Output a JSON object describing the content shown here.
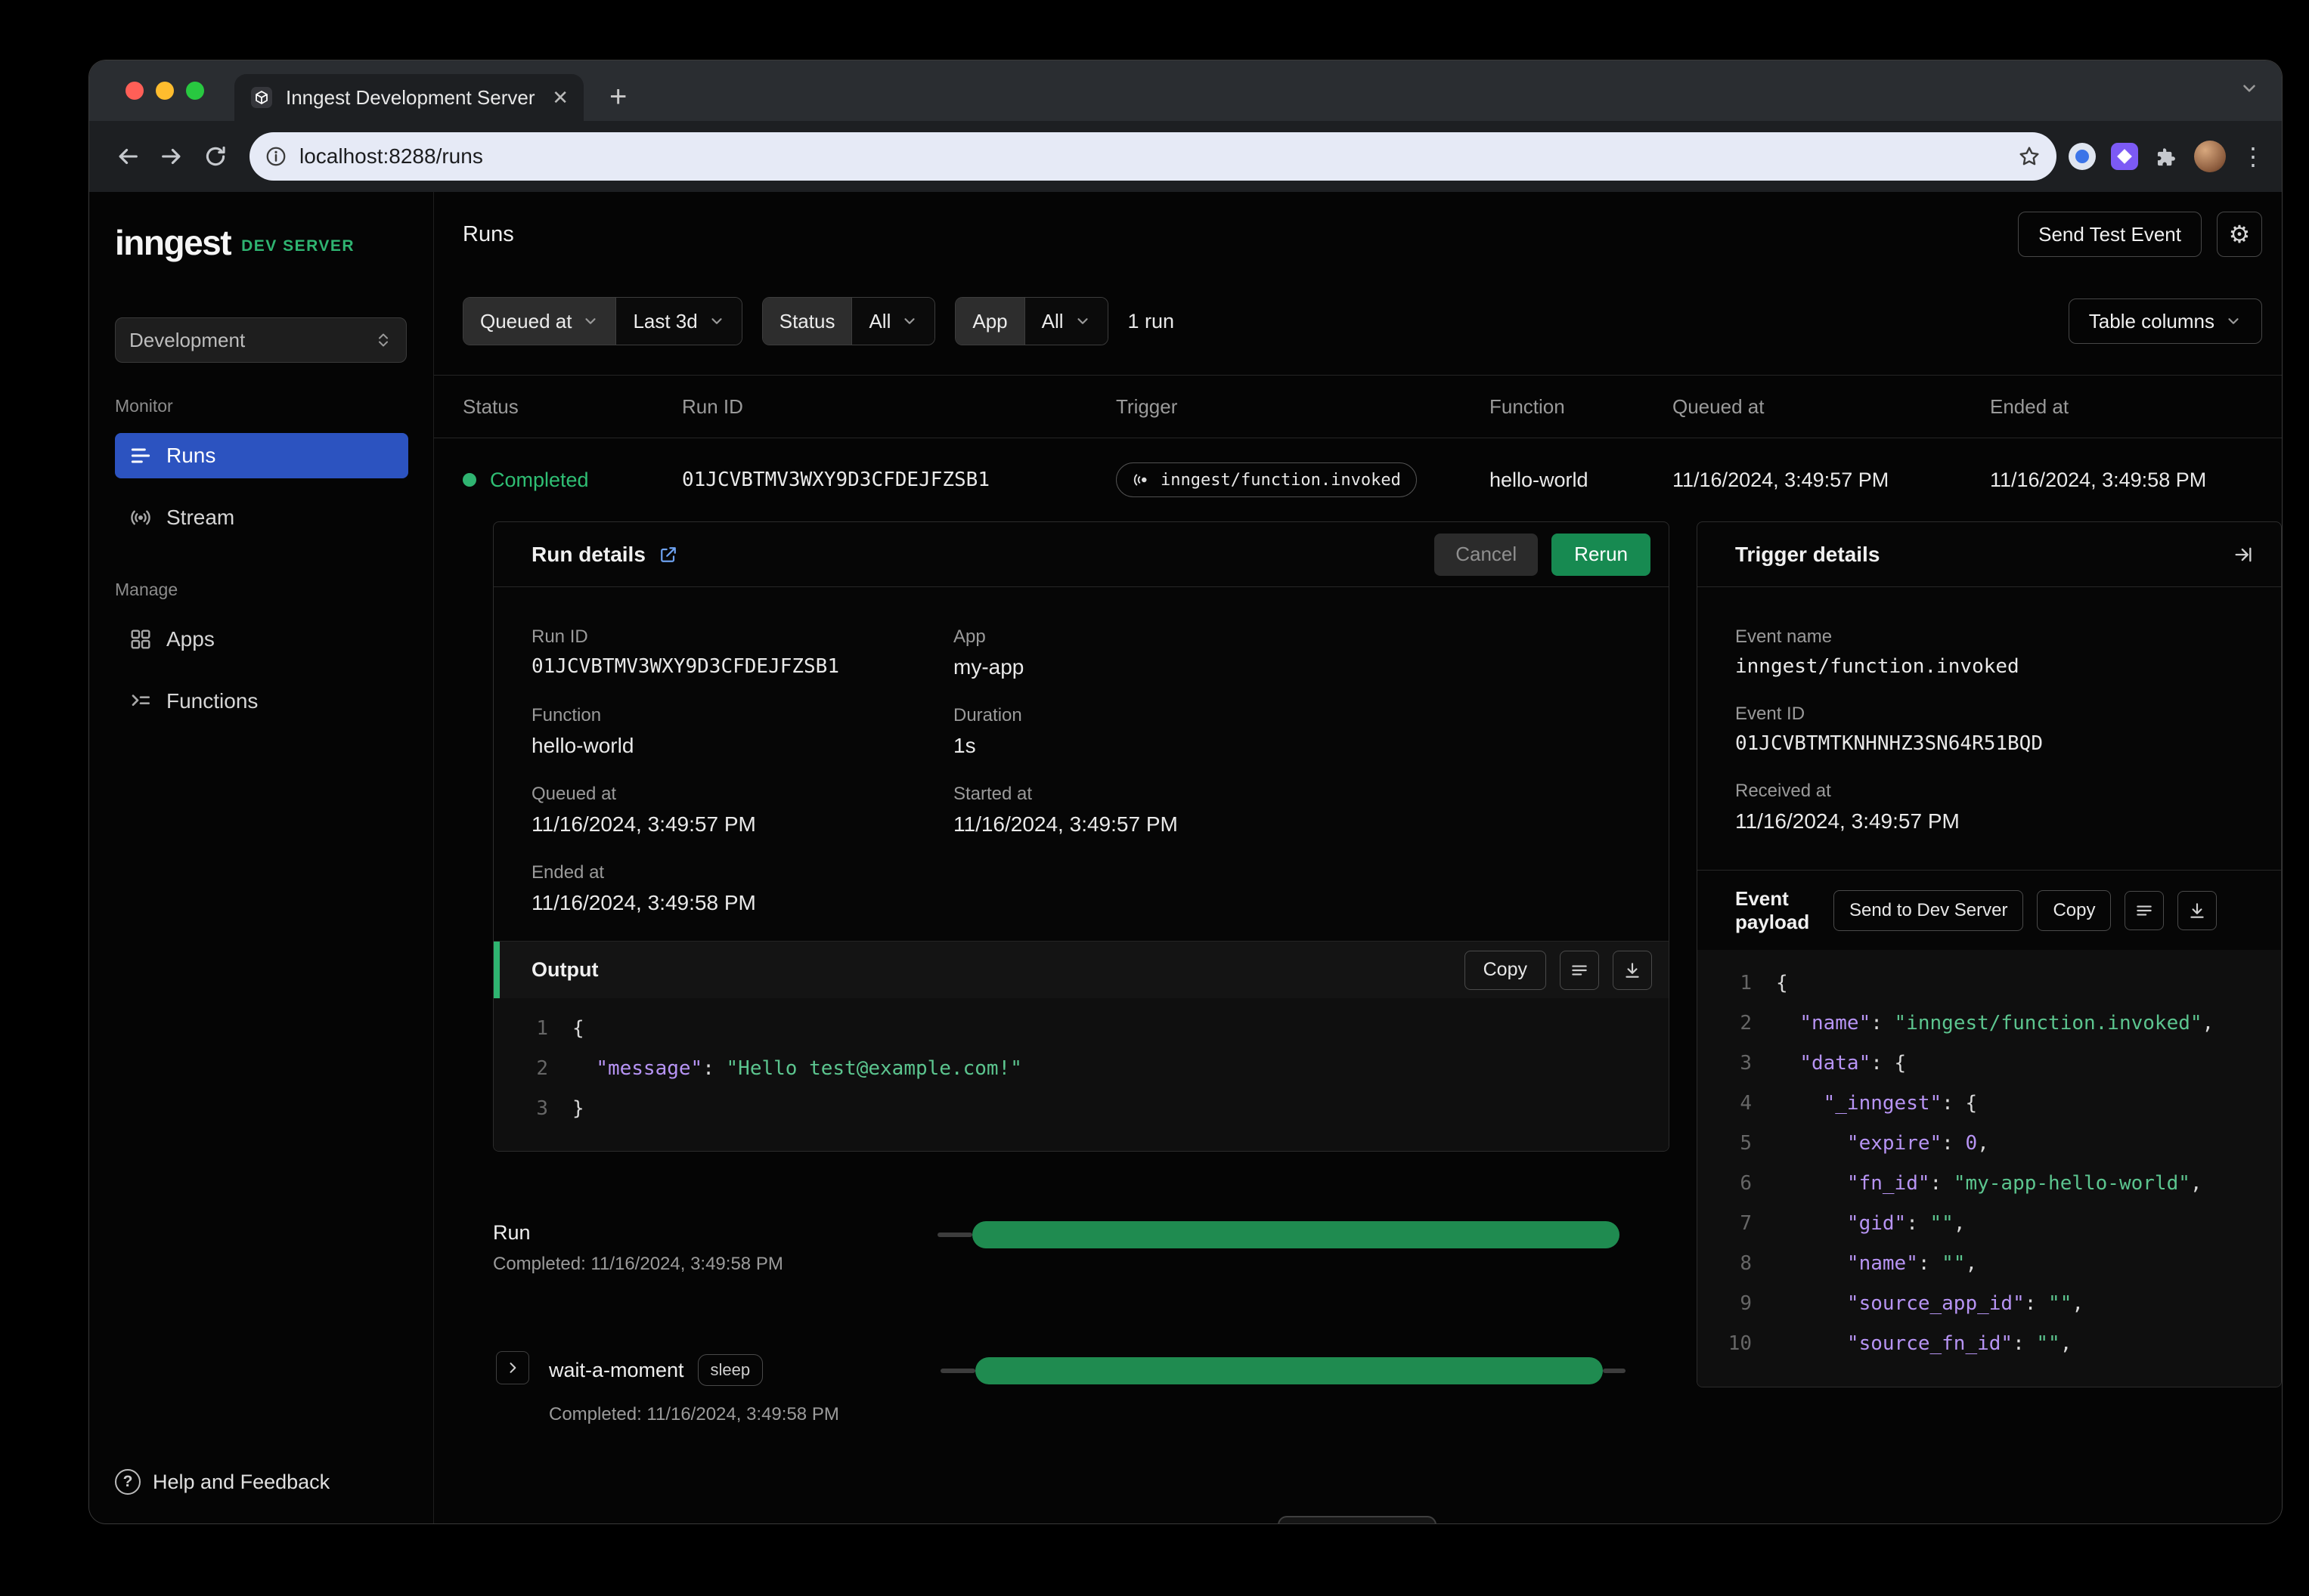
{
  "browser": {
    "tab_title": "Inngest Development Server",
    "url": "localhost:8288/runs"
  },
  "sidebar": {
    "logo": "inngest",
    "badge": "DEV SERVER",
    "env": "Development",
    "monitor_label": "Monitor",
    "runs": "Runs",
    "stream": "Stream",
    "manage_label": "Manage",
    "apps": "Apps",
    "functions": "Functions",
    "help": "Help and Feedback"
  },
  "header": {
    "title": "Runs",
    "send_test_event": "Send Test Event"
  },
  "filters": {
    "field": "Queued at",
    "range": "Last 3d",
    "status_label": "Status",
    "status_value": "All",
    "app_label": "App",
    "app_value": "All",
    "run_count": "1 run",
    "table_columns": "Table columns"
  },
  "table": {
    "columns": [
      "Status",
      "Run ID",
      "Trigger",
      "Function",
      "Queued at",
      "Ended at"
    ],
    "row": {
      "status": "Completed",
      "run_id": "01JCVBTMV3WXY9D3CFDEJFZSB1",
      "trigger": "inngest/function.invoked",
      "function": "hello-world",
      "queued_at": "11/16/2024, 3:49:57 PM",
      "ended_at": "11/16/2024, 3:49:58 PM"
    }
  },
  "run_details": {
    "title": "Run details",
    "cancel": "Cancel",
    "rerun": "Rerun",
    "fields": {
      "run_id_label": "Run ID",
      "run_id": "01JCVBTMV3WXY9D3CFDEJFZSB1",
      "app_label": "App",
      "app": "my-app",
      "function_label": "Function",
      "function": "hello-world",
      "duration_label": "Duration",
      "duration": "1s",
      "queued_label": "Queued at",
      "queued": "11/16/2024, 3:49:57 PM",
      "started_label": "Started at",
      "started": "11/16/2024, 3:49:57 PM",
      "ended_label": "Ended at",
      "ended": "11/16/2024, 3:49:58 PM"
    },
    "output": {
      "title": "Output",
      "copy": "Copy",
      "lines": [
        {
          "n": "1",
          "t": [
            [
              "p",
              "{"
            ]
          ]
        },
        {
          "n": "2",
          "t": [
            [
              "p",
              "  "
            ],
            [
              "k",
              "\"message\""
            ],
            [
              "p",
              ": "
            ],
            [
              "s",
              "\"Hello test@example.com!\""
            ]
          ]
        },
        {
          "n": "3",
          "t": [
            [
              "p",
              "}"
            ]
          ]
        }
      ]
    }
  },
  "timeline": {
    "run_label": "Run",
    "run_completed": "Completed: 11/16/2024, 3:49:58 PM",
    "step_label": "wait-a-moment",
    "step_badge": "sleep",
    "step_completed": "Completed: 11/16/2024, 3:49:58 PM"
  },
  "trigger_details": {
    "title": "Trigger details",
    "event_name_label": "Event name",
    "event_name": "inngest/function.invoked",
    "event_id_label": "Event ID",
    "event_id": "01JCVBTMTKNHNHZ3SN64R51BQD",
    "received_label": "Received at",
    "received": "11/16/2024, 3:49:57 PM",
    "payload": {
      "title": "Event payload",
      "send": "Send to Dev Server",
      "copy": "Copy",
      "lines": [
        {
          "n": "1",
          "t": [
            [
              "p",
              "{"
            ]
          ]
        },
        {
          "n": "2",
          "t": [
            [
              "p",
              "  "
            ],
            [
              "k",
              "\"name\""
            ],
            [
              "p",
              ": "
            ],
            [
              "s",
              "\"inngest/function.invoked\""
            ],
            [
              "p",
              ","
            ]
          ]
        },
        {
          "n": "3",
          "t": [
            [
              "p",
              "  "
            ],
            [
              "k",
              "\"data\""
            ],
            [
              "p",
              ": {"
            ]
          ]
        },
        {
          "n": "4",
          "t": [
            [
              "p",
              "    "
            ],
            [
              "k",
              "\"_inngest\""
            ],
            [
              "p",
              ": {"
            ]
          ]
        },
        {
          "n": "5",
          "t": [
            [
              "p",
              "      "
            ],
            [
              "k",
              "\"expire\""
            ],
            [
              "p",
              ": "
            ],
            [
              "n",
              "0"
            ],
            [
              "p",
              ","
            ]
          ]
        },
        {
          "n": "6",
          "t": [
            [
              "p",
              "      "
            ],
            [
              "k",
              "\"fn_id\""
            ],
            [
              "p",
              ": "
            ],
            [
              "s",
              "\"my-app-hello-world\""
            ],
            [
              "p",
              ","
            ]
          ]
        },
        {
          "n": "7",
          "t": [
            [
              "p",
              "      "
            ],
            [
              "k",
              "\"gid\""
            ],
            [
              "p",
              ": "
            ],
            [
              "s",
              "\"\""
            ],
            [
              "p",
              ","
            ]
          ]
        },
        {
          "n": "8",
          "t": [
            [
              "p",
              "      "
            ],
            [
              "k",
              "\"name\""
            ],
            [
              "p",
              ": "
            ],
            [
              "s",
              "\"\""
            ],
            [
              "p",
              ","
            ]
          ]
        },
        {
          "n": "9",
          "t": [
            [
              "p",
              "      "
            ],
            [
              "k",
              "\"source_app_id\""
            ],
            [
              "p",
              ": "
            ],
            [
              "s",
              "\"\""
            ],
            [
              "p",
              ","
            ]
          ]
        },
        {
          "n": "10",
          "t": [
            [
              "p",
              "      "
            ],
            [
              "k",
              "\"source_fn_id\""
            ],
            [
              "p",
              ": "
            ],
            [
              "s",
              "\"\""
            ],
            [
              "p",
              ","
            ]
          ]
        }
      ]
    }
  },
  "colors": {
    "accent_green": "#2fb471",
    "bar_green": "#1f8b50",
    "link_blue": "#5ba0f0",
    "active_nav_blue": "#2c53c0",
    "json_key_violet": "#b794f4",
    "json_string_green": "#5cc58f"
  }
}
